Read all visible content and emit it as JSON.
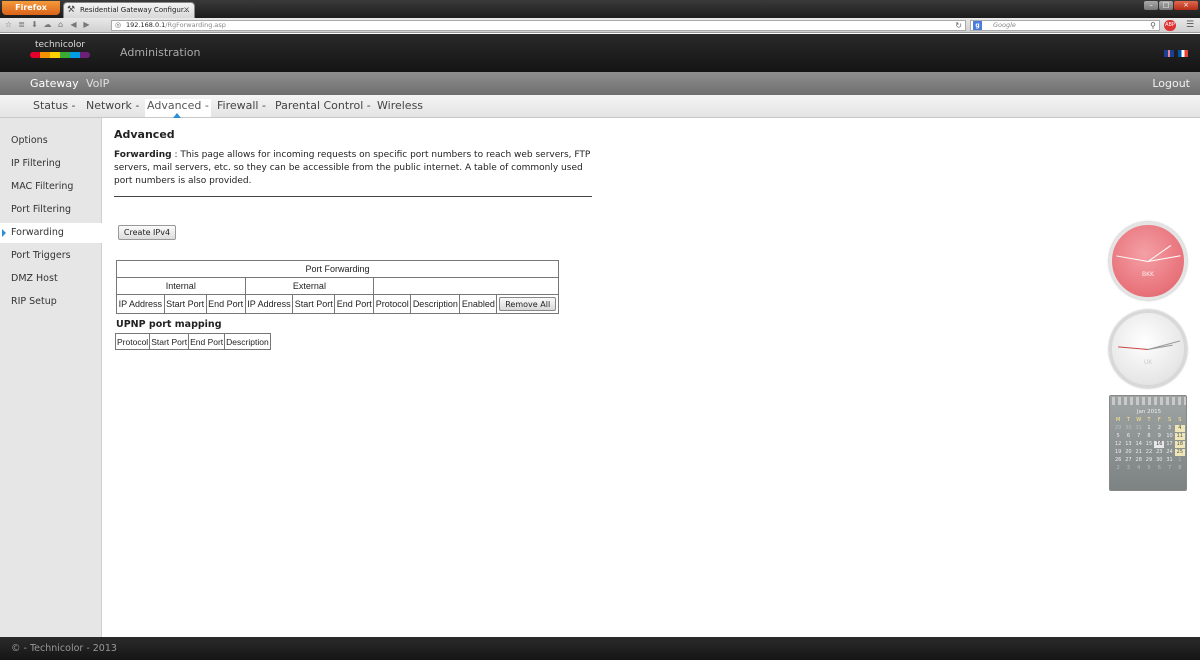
{
  "browser": {
    "menu_label": "Firefox",
    "tab_title": "Residential Gateway Configur...",
    "tab_close": "×",
    "url_host": "192.168.0.1",
    "url_path": "/RgForwarding.asp",
    "search_placeholder": "Google",
    "win_minimize": "–",
    "win_maximize": "□",
    "win_close": "×"
  },
  "header": {
    "logo_text": "technicolor",
    "logo_colors": [
      "#e4002b",
      "#f39200",
      "#ffd100",
      "#3aaa35",
      "#009fe3",
      "#6d2077"
    ],
    "title": "Administration"
  },
  "top_menu": {
    "items": [
      "Gateway",
      "VoIP"
    ],
    "logout": "Logout"
  },
  "sub_menu": {
    "items": [
      "Status -",
      "Network -",
      "Advanced -",
      "Firewall -",
      "Parental Control -",
      "Wireless"
    ],
    "active": "Advanced -"
  },
  "sidebar": {
    "items": [
      "Options",
      "IP Filtering",
      "MAC Filtering",
      "Port Filtering",
      "Forwarding",
      "Port Triggers",
      "DMZ Host",
      "RIP Setup"
    ],
    "active": "Forwarding"
  },
  "main": {
    "title": "Advanced",
    "desc_label": "Forwarding",
    "desc_sep": ":",
    "desc_text": "This page allows for incoming requests on specific port numbers to reach web servers, FTP servers, mail servers, etc. so they can be accessible from the public internet. A table of commonly used port numbers is also provided.",
    "create_button": "Create IPv4",
    "port_forwarding": {
      "caption": "Port Forwarding",
      "group_internal": "Internal",
      "group_external": "External",
      "columns": [
        "IP Address",
        "Start Port",
        "End Port",
        "IP Address",
        "Start Port",
        "End Port",
        "Protocol",
        "Description",
        "Enabled"
      ],
      "remove_all": "Remove All"
    },
    "upnp": {
      "title": "UPNP port mapping",
      "columns": [
        "Protocol",
        "Start Port",
        "End Port",
        "Description"
      ]
    }
  },
  "widgets": {
    "clock1_label": "BKK",
    "clock2_label": "UK",
    "calendar_month": "Jan 2015",
    "calendar_weekdays": [
      "M",
      "T",
      "W",
      "T",
      "F",
      "S",
      "S"
    ],
    "calendar_days": [
      "29",
      "30",
      "31",
      "1",
      "2",
      "3",
      "4",
      "5",
      "6",
      "7",
      "8",
      "9",
      "10",
      "11",
      "12",
      "13",
      "14",
      "15",
      "16",
      "17",
      "18",
      "19",
      "20",
      "21",
      "22",
      "23",
      "24",
      "25",
      "26",
      "27",
      "28",
      "29",
      "30",
      "31",
      "1",
      "2",
      "3",
      "4",
      "5",
      "6",
      "7",
      "8"
    ],
    "calendar_today": "16"
  },
  "footer": {
    "text": "© - Technicolor - 2013"
  }
}
